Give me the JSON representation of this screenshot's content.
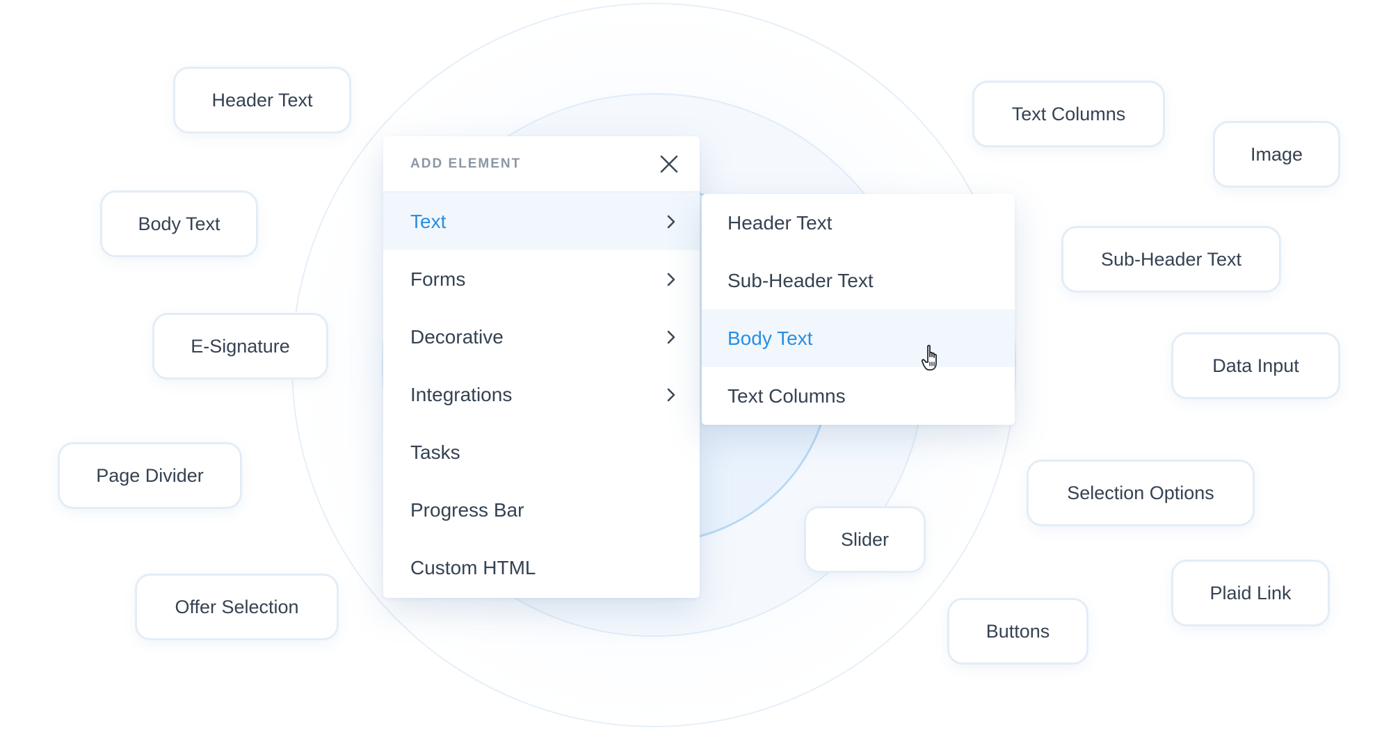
{
  "menu": {
    "title": "ADD ELEMENT",
    "items": [
      {
        "label": "Text",
        "has_submenu": true,
        "active": true
      },
      {
        "label": "Forms",
        "has_submenu": true
      },
      {
        "label": "Decorative",
        "has_submenu": true
      },
      {
        "label": "Integrations",
        "has_submenu": true
      },
      {
        "label": "Tasks",
        "has_submenu": false
      },
      {
        "label": "Progress Bar",
        "has_submenu": false
      },
      {
        "label": "Custom HTML",
        "has_submenu": false
      }
    ]
  },
  "submenu": {
    "items": [
      {
        "label": "Header Text"
      },
      {
        "label": "Sub-Header Text"
      },
      {
        "label": "Body Text",
        "active": true
      },
      {
        "label": "Text Columns"
      }
    ]
  },
  "chips": [
    "Header Text",
    "Body Text",
    "E-Signature",
    "Page Divider",
    "Offer Selection",
    "Text Columns",
    "Image",
    "Sub-Header Text",
    "Data Input",
    "Selection Options",
    "Slider",
    "Plaid Link",
    "Buttons"
  ],
  "icons": {
    "close": "close-icon",
    "chevron": "chevron-right-icon",
    "cursor": "hand-pointer-icon"
  },
  "colors": {
    "accent": "#2a8ee0",
    "text": "#354252",
    "muted": "#8a97a6",
    "active_bg": "#f1f7fd",
    "chip_border": "#e3edf7"
  }
}
